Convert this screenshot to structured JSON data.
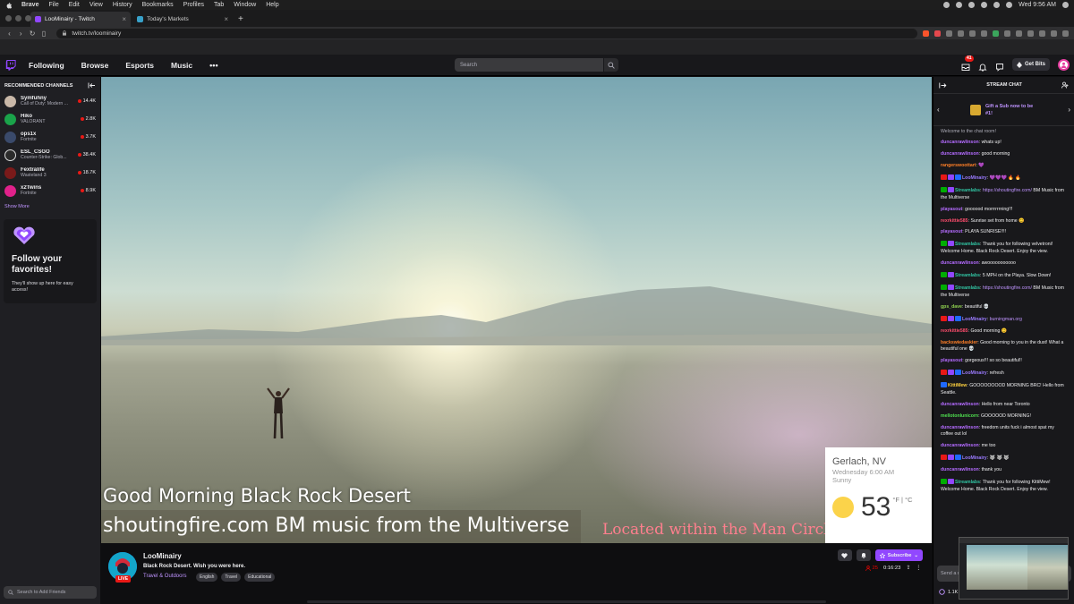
{
  "menubar": {
    "app": "Brave",
    "items": [
      "File",
      "Edit",
      "View",
      "History",
      "Bookmarks",
      "Profiles",
      "Tab",
      "Window",
      "Help"
    ],
    "clock": "Wed 9:56 AM"
  },
  "browser": {
    "tabs": [
      {
        "title": "LooMinairy - Twitch",
        "active": true
      },
      {
        "title": "Today's Markets",
        "active": false
      }
    ],
    "url": "twitch.tv/loominairy",
    "brave_shield_count": "20",
    "rewards_count": "9"
  },
  "topnav": {
    "links": [
      "Following",
      "Browse",
      "Esports",
      "Music"
    ],
    "more": "•••",
    "search_placeholder": "Search",
    "notifications_badge": "41",
    "get_bits": "Get Bits"
  },
  "sidebar": {
    "heading": "RECOMMENDED CHANNELS",
    "channels": [
      {
        "name": "Symfuhny",
        "game": "Call of Duty: Modern ...",
        "viewers": "14.4K",
        "color": "#c9b8a8"
      },
      {
        "name": "Hiko",
        "game": "VALORANT",
        "viewers": "2.8K",
        "color": "#1aa34a"
      },
      {
        "name": "ops1x",
        "game": "Fortnite",
        "viewers": "3.7K",
        "color": "#3a4a6b"
      },
      {
        "name": "ESL_CSGO",
        "game": "Counter-Strike: Glob...",
        "viewers": "38.4K",
        "color": "#2b2b2b"
      },
      {
        "name": "Fextralife",
        "game": "Wasteland 3",
        "viewers": "18.7K",
        "color": "#7a1a1a"
      },
      {
        "name": "x2Twins",
        "game": "Fortnite",
        "viewers": "8.9K",
        "color": "#e0218a"
      }
    ],
    "show_more": "Show More",
    "follow_card": {
      "title": "Follow your favorites!",
      "subtitle": "They'll show up here for easy access!"
    },
    "add_friends_placeholder": "Search to Add Friends"
  },
  "video": {
    "overlay_line1": "Good Morning Black Rock Desert",
    "overlay_line2": "shoutingfire.com BM music from the Multiverse",
    "overlay_line3": "Located within the Man Circle",
    "weather": {
      "city": "Gerlach, NV",
      "datetime": "Wednesday 6:00 AM",
      "condition": "Sunny",
      "temperature": "53",
      "unit": "°F | °C"
    }
  },
  "stream": {
    "channel": "LooMinairy",
    "title": "Black Rock Desert. Wish you were here.",
    "category": "Travel & Outdoors",
    "tags": [
      "English",
      "Travel",
      "Educational"
    ],
    "live_label": "LIVE",
    "viewers": "25",
    "uptime": "0:16:23",
    "subscribe": "Subscribe"
  },
  "chat": {
    "title": "STREAM CHAT",
    "gift_prompt": "Gift a Sub now to be #1!",
    "welcome": "Welcome to the chat room!",
    "messages": [
      {
        "user": "duncanrawlinson",
        "color": "#b46bff",
        "text": "whats up!",
        "badges": []
      },
      {
        "user": "duncanrawlinson",
        "color": "#b46bff",
        "text": "good morning",
        "badges": []
      },
      {
        "user": "rangerswoottart",
        "color": "#ff7f27",
        "text": "💜",
        "badges": []
      },
      {
        "user": "LooMinairy",
        "color": "#9b7bff",
        "text": "💜💜💜 🔥 🔥",
        "badges": [
          "#e91916",
          "#9147ff",
          "#1f69ff"
        ]
      },
      {
        "user": "Streamlabs",
        "color": "#31c3a2",
        "text": "",
        "link": "https://shoutingfire.com/",
        "after": " BM Music from the Multiverse",
        "badges": [
          "#00ad03",
          "#9147ff"
        ]
      },
      {
        "user": "playasout",
        "color": "#b46bff",
        "text": "goooood morrrrrrning!!!",
        "badges": []
      },
      {
        "user": "rexrkittie585",
        "color": "#ff4d6d",
        "text": "Sunrise set from home 😊",
        "badges": []
      },
      {
        "user": "playasout",
        "color": "#b46bff",
        "text": "PLAYA SUNRISE!!!!",
        "badges": []
      },
      {
        "user": "Streamlabs",
        "color": "#31c3a2",
        "text": "Thank you for following velvetroni! Welcome Home. Black Rock Desert. Enjoy the view.",
        "badges": [
          "#00ad03",
          "#9147ff"
        ]
      },
      {
        "user": "duncanrawlinson",
        "color": "#b46bff",
        "text": "awooooooooooo",
        "badges": []
      },
      {
        "user": "Streamlabs",
        "color": "#31c3a2",
        "text": "5 MPH on the Playa. Slow Down!",
        "badges": [
          "#00ad03",
          "#9147ff"
        ]
      },
      {
        "user": "Streamlabs",
        "color": "#31c3a2",
        "text": "",
        "link": "https://shoutingfire.com/",
        "after": " BM Music from the Multiverse",
        "badges": [
          "#00ad03",
          "#9147ff"
        ]
      },
      {
        "user": "gps_dave",
        "color": "#8fd14f",
        "text": "beautiful 💀",
        "badges": []
      },
      {
        "user": "LooMinairy",
        "color": "#9b7bff",
        "text": "",
        "link": "burningman.org",
        "after": "",
        "badges": [
          "#e91916",
          "#9147ff",
          "#1f69ff"
        ]
      },
      {
        "user": "rexrkittie585",
        "color": "#ff4d6d",
        "text": "Good morning 😊",
        "badges": []
      },
      {
        "user": "backswiedaskier",
        "color": "#ff7f27",
        "text": "Good morning to you in the dust! What a beautiful one 💀",
        "badges": []
      },
      {
        "user": "playasout",
        "color": "#b46bff",
        "text": "gorgeous!!! so so beautiful!!",
        "badges": []
      },
      {
        "user": "LooMinairy",
        "color": "#9b7bff",
        "text": "refresh",
        "badges": [
          "#e91916",
          "#9147ff",
          "#1f69ff"
        ]
      },
      {
        "user": "KittiMew",
        "color": "#ffd23f",
        "text": "GOOOOOOOOD MORNING BRC! Hello from Seattle.",
        "badges": [
          "#1f69ff"
        ]
      },
      {
        "user": "duncanrawlinson",
        "color": "#b46bff",
        "text": "Hello from near Toronto",
        "badges": []
      },
      {
        "user": "mellotonlunicorn",
        "color": "#4fe04f",
        "text": "GOOOOOD MORNING!",
        "badges": []
      },
      {
        "user": "duncanrawlinson",
        "color": "#b46bff",
        "text": "freedom units fuck i almost spat my coffee out lol",
        "badges": []
      },
      {
        "user": "duncanrawlinson",
        "color": "#b46bff",
        "text": "me too",
        "badges": []
      },
      {
        "user": "LooMinairy",
        "color": "#9b7bff",
        "text": "🐺 🐺 🐺",
        "badges": [
          "#e91916",
          "#9147ff",
          "#1f69ff"
        ]
      },
      {
        "user": "duncanrawlinson",
        "color": "#b46bff",
        "text": "thank you",
        "badges": []
      },
      {
        "user": "Streamlabs",
        "color": "#31c3a2",
        "text": "Thank you for following KittiMew! Welcome Home. Black Rock Desert. Enjoy the view.",
        "badges": [
          "#00ad03",
          "#9147ff"
        ]
      }
    ],
    "input_placeholder": "Send a message",
    "points": "1.1K"
  },
  "colors": {
    "twitch_purple": "#9147ff",
    "live_red": "#e91916",
    "link_purple": "#bf94ff"
  }
}
